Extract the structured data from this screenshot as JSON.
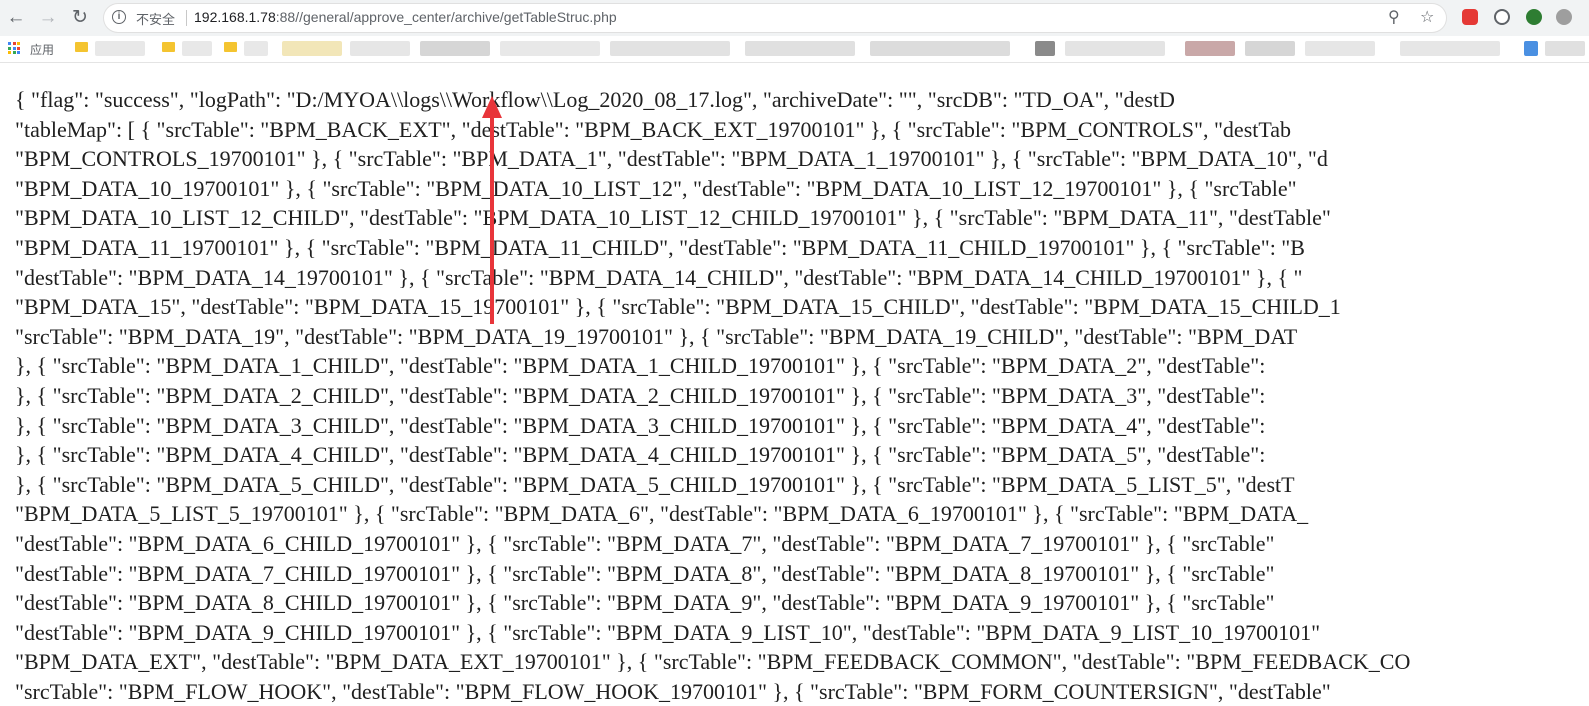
{
  "browser": {
    "security_label": "不安全",
    "url_host": "192.168.1.78",
    "url_path": ":88//general/approve_center/archive/getTableStruc.php",
    "bookmarks_apps_label": "应用"
  },
  "response_lines": [
    "{ \"flag\": \"success\", \"logPath\": \"D:/MYOA\\\\logs\\\\Workflow\\\\Log_2020_08_17.log\", \"archiveDate\": \"\", \"srcDB\": \"TD_OA\", \"destD",
    "\"tableMap\": [ { \"srcTable\": \"BPM_BACK_EXT\", \"destTable\": \"BPM_BACK_EXT_19700101\" }, { \"srcTable\": \"BPM_CONTROLS\", \"destTab",
    "\"BPM_CONTROLS_19700101\" }, { \"srcTable\": \"BPM_DATA_1\", \"destTable\": \"BPM_DATA_1_19700101\" }, { \"srcTable\": \"BPM_DATA_10\", \"d",
    "\"BPM_DATA_10_19700101\" }, { \"srcTable\": \"BPM_DATA_10_LIST_12\", \"destTable\": \"BPM_DATA_10_LIST_12_19700101\" }, { \"srcTable\"",
    "\"BPM_DATA_10_LIST_12_CHILD\", \"destTable\": \"BPM_DATA_10_LIST_12_CHILD_19700101\" }, { \"srcTable\": \"BPM_DATA_11\", \"destTable\"",
    "\"BPM_DATA_11_19700101\" }, { \"srcTable\": \"BPM_DATA_11_CHILD\", \"destTable\": \"BPM_DATA_11_CHILD_19700101\" }, { \"srcTable\": \"B",
    "\"destTable\": \"BPM_DATA_14_19700101\" }, { \"srcTable\": \"BPM_DATA_14_CHILD\", \"destTable\": \"BPM_DATA_14_CHILD_19700101\" }, { \"",
    "\"BPM_DATA_15\", \"destTable\": \"BPM_DATA_15_19700101\" }, { \"srcTable\": \"BPM_DATA_15_CHILD\", \"destTable\": \"BPM_DATA_15_CHILD_1",
    "\"srcTable\": \"BPM_DATA_19\", \"destTable\": \"BPM_DATA_19_19700101\" }, { \"srcTable\": \"BPM_DATA_19_CHILD\", \"destTable\": \"BPM_DAT",
    "}, { \"srcTable\": \"BPM_DATA_1_CHILD\", \"destTable\": \"BPM_DATA_1_CHILD_19700101\" }, { \"srcTable\": \"BPM_DATA_2\", \"destTable\":",
    "}, { \"srcTable\": \"BPM_DATA_2_CHILD\", \"destTable\": \"BPM_DATA_2_CHILD_19700101\" }, { \"srcTable\": \"BPM_DATA_3\", \"destTable\":",
    "}, { \"srcTable\": \"BPM_DATA_3_CHILD\", \"destTable\": \"BPM_DATA_3_CHILD_19700101\" }, { \"srcTable\": \"BPM_DATA_4\", \"destTable\":",
    "}, { \"srcTable\": \"BPM_DATA_4_CHILD\", \"destTable\": \"BPM_DATA_4_CHILD_19700101\" }, { \"srcTable\": \"BPM_DATA_5\", \"destTable\":",
    "}, { \"srcTable\": \"BPM_DATA_5_CHILD\", \"destTable\": \"BPM_DATA_5_CHILD_19700101\" }, { \"srcTable\": \"BPM_DATA_5_LIST_5\", \"destT",
    "\"BPM_DATA_5_LIST_5_19700101\" }, { \"srcTable\": \"BPM_DATA_6\", \"destTable\": \"BPM_DATA_6_19700101\" }, { \"srcTable\": \"BPM_DATA_",
    "\"destTable\": \"BPM_DATA_6_CHILD_19700101\" }, { \"srcTable\": \"BPM_DATA_7\", \"destTable\": \"BPM_DATA_7_19700101\" }, { \"srcTable\"",
    "\"destTable\": \"BPM_DATA_7_CHILD_19700101\" }, { \"srcTable\": \"BPM_DATA_8\", \"destTable\": \"BPM_DATA_8_19700101\" }, { \"srcTable\"",
    "\"destTable\": \"BPM_DATA_8_CHILD_19700101\" }, { \"srcTable\": \"BPM_DATA_9\", \"destTable\": \"BPM_DATA_9_19700101\" }, { \"srcTable\"",
    "\"destTable\": \"BPM_DATA_9_CHILD_19700101\" }, { \"srcTable\": \"BPM_DATA_9_LIST_10\", \"destTable\": \"BPM_DATA_9_LIST_10_19700101\"",
    "\"BPM_DATA_EXT\", \"destTable\": \"BPM_DATA_EXT_19700101\" }, { \"srcTable\": \"BPM_FEEDBACK_COMMON\", \"destTable\": \"BPM_FEEDBACK_CO",
    "\"srcTable\": \"BPM_FLOW_HOOK\", \"destTable\": \"BPM_FLOW_HOOK_19700101\" }, { \"srcTable\": \"BPM_FORM_COUNTERSIGN\", \"destTable\""
  ]
}
